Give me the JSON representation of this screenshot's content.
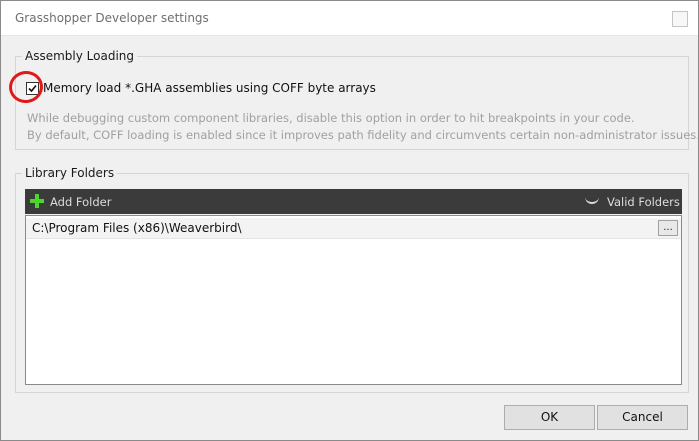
{
  "window": {
    "title": "Grasshopper Developer settings"
  },
  "assembly_loading": {
    "legend": "Assembly Loading",
    "checkbox_label": "Memory load *.GHA assemblies using COFF byte arrays",
    "checkbox_checked": true,
    "description_line1": "While debugging custom component libraries, disable this option in order to hit breakpoints in your code.",
    "description_line2": "By default, COFF loading is enabled since it improves path fidelity and circumvents certain non-administrator issues."
  },
  "library_folders": {
    "legend": "Library Folders",
    "toolbar": {
      "add_folder": "Add Folder",
      "valid_folders": "Valid Folders"
    },
    "items": [
      {
        "path": "C:\\Program Files (x86)\\Weaverbird\\",
        "browse": "..."
      }
    ]
  },
  "buttons": {
    "ok": "OK",
    "cancel": "Cancel"
  },
  "colors": {
    "annotation_circle": "#e01818",
    "add_icon": "#4cd62c",
    "toolbar_bg": "#3b3b3b"
  }
}
